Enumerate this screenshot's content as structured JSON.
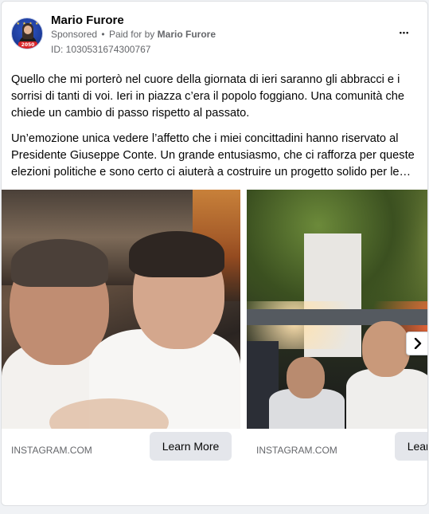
{
  "page": {
    "advertiser_name": "Mario Furore",
    "sponsored_label": "Sponsored",
    "separator": "•",
    "paid_for_prefix": "Paid for by",
    "paid_for_name": "Mario Furore",
    "ad_id": "ID: 1030531674300767",
    "more_glyph": "•••"
  },
  "avatar": {
    "badge_text": "2050"
  },
  "post": {
    "paragraph1": "Quello che mi porterò nel cuore della giornata di ieri saranno gli abbracci e i sorrisi di tanti di voi. Ieri in piazza c’era il popolo foggiano. Una comunità che chiede un cambio di passo rispetto al passato.",
    "paragraph2": "Un’emozione unica vedere l’affetto che i miei concittadini hanno riservato al Presidente Giuseppe Conte. Un grande entusiasmo, che ci rafforza per queste elezioni politiche e sono certo ci aiuterà a costruire un progetto solido per le…"
  },
  "carousel": {
    "cards": [
      {
        "domain": "INSTAGRAM.COM",
        "cta": "Learn More"
      },
      {
        "domain": "INSTAGRAM.COM",
        "cta": "Learn More"
      }
    ],
    "next_icon": "chevron-right-icon"
  },
  "colors": {
    "text_primary": "#050505",
    "text_secondary": "#65676b",
    "button_bg": "#e4e6eb",
    "card_border": "#dddfe2"
  }
}
